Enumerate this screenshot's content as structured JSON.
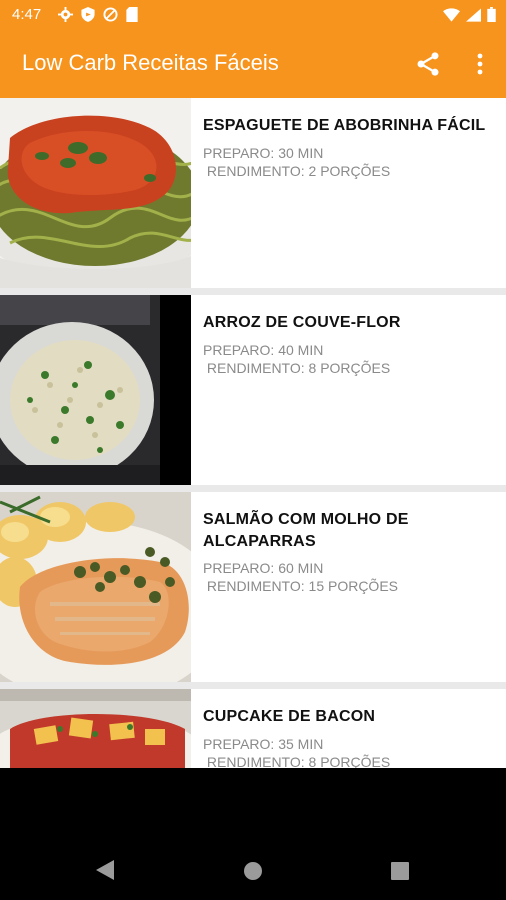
{
  "status_bar": {
    "time": "4:47",
    "left_icons": [
      "settings-icon",
      "shield-icon",
      "sync-icon",
      "sd-card-icon"
    ],
    "right_icons": [
      "wifi-icon",
      "signal-icon",
      "battery-icon"
    ]
  },
  "app_bar": {
    "title": "Low Carb Receitas Fáceis",
    "actions": [
      "share-icon",
      "more-vert-icon"
    ],
    "color": "#F7941D"
  },
  "recipes": [
    {
      "title": "ESPAGUETE DE ABOBRINHA FÁCIL",
      "preparo": "PREPARO: 30 MIN",
      "rendimento": " RENDIMENTO: 2 PORÇÕES"
    },
    {
      "title": "ARROZ DE COUVE-FLOR",
      "preparo": "PREPARO: 40 MIN",
      "rendimento": " RENDIMENTO: 8 PORÇÕES"
    },
    {
      "title": "SALMÃO COM MOLHO DE ALCAPARRAS",
      "preparo": "PREPARO: 60 MIN",
      "rendimento": " RENDIMENTO: 15 PORÇÕES"
    },
    {
      "title": "CUPCAKE DE BACON",
      "preparo": "PREPARO: 35 MIN",
      "rendimento": " RENDIMENTO: 8 PORÇÕES"
    }
  ],
  "nav_bar": {
    "buttons": [
      "back-icon",
      "home-icon",
      "recents-icon"
    ]
  }
}
